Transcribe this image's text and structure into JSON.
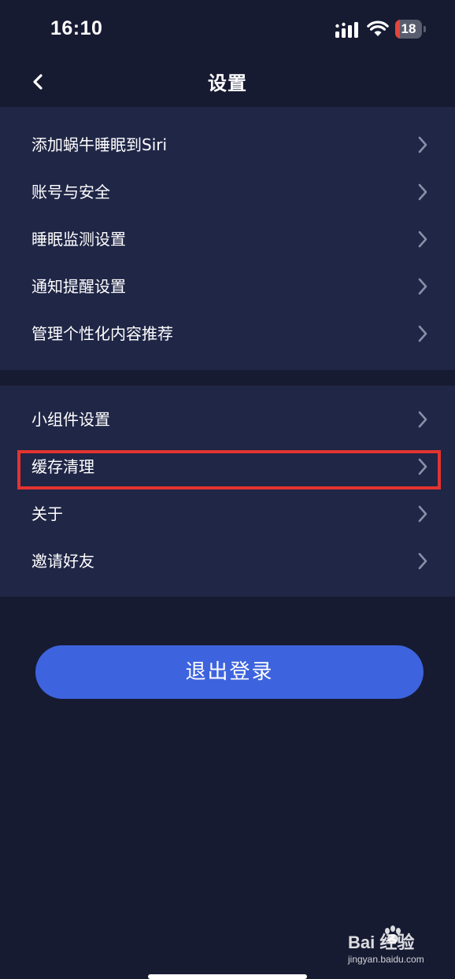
{
  "status_bar": {
    "time": "16:10",
    "battery_level": "18",
    "battery_fraction": 0.18,
    "icons": [
      "signal-icon",
      "wifi-icon",
      "battery-icon"
    ]
  },
  "nav": {
    "title": "设置",
    "back_icon": "chevron-left-icon"
  },
  "groups": [
    {
      "items": [
        {
          "label": "添加蜗牛睡眠到Siri"
        },
        {
          "label": "账号与安全"
        },
        {
          "label": "睡眠监测设置"
        },
        {
          "label": "通知提醒设置"
        },
        {
          "label": "管理个性化内容推荐"
        }
      ]
    },
    {
      "items": [
        {
          "label": "小组件设置"
        },
        {
          "label": "缓存清理",
          "highlighted": true
        },
        {
          "label": "关于"
        },
        {
          "label": "邀请好友"
        }
      ]
    }
  ],
  "logout_label": "退出登录",
  "watermark": {
    "brand": "Bai  经验",
    "url": "jingyan.baidu.com"
  },
  "colors": {
    "background": "#171b32",
    "group_background": "#202646",
    "accent": "#3d63de",
    "highlight": "#e2342f",
    "battery_low": "#e2453c"
  }
}
